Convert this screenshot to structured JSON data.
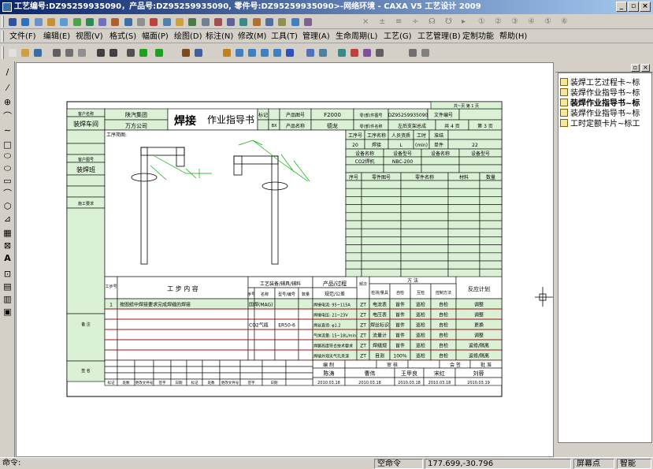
{
  "window": {
    "title": "工艺编号:DZ95259935090，产品号:DZ95259935090, 零件号:DZ95259935090>-网络环境 - CAXA V5 工艺设计 2009"
  },
  "menu": [
    "文件(F)",
    "编辑(E)",
    "视图(V)",
    "格式(S)",
    "幅面(P)",
    "绘图(D)",
    "标注(N)",
    "修改(M)",
    "工具(T)",
    "管理(A)",
    "生命周期(L)",
    "工艺(G)",
    "工艺管理(B)",
    "定制功能",
    "帮助(H)"
  ],
  "tb1_right": [
    "×",
    "±",
    "≡",
    "÷",
    "☊",
    "☋",
    "▸",
    "①",
    "②",
    "③",
    "④",
    "⑤",
    "⑥"
  ],
  "panel": {
    "files": [
      "装焊工艺过程卡~标",
      "装焊作业指导书~标",
      "装焊作业指导书~标",
      "装焊作业指导书~标",
      "工时定额卡片~标工"
    ]
  },
  "status": {
    "left": "命令:",
    "cmd": "空命令",
    "coords": "177.699,-30.796",
    "snap_label": "屏幕点",
    "mode": "智能"
  },
  "doc": {
    "top_tag": "共~页 第 1 页",
    "hdr_label1": "客户名称",
    "hdr_val1": "装焊车间",
    "cust_name": "陕汽集团",
    "cust_co": "万方公司",
    "title_big": "焊接",
    "title_rest": "作业指导书",
    "mark": "标记",
    "bi": "BX",
    "p_code_l": "产品图号",
    "p_code": "F2000",
    "p_name_l": "产品名称",
    "p_name": "德龙",
    "part_code_l": "零(部)件图号",
    "part_code": "DZ95259935090",
    "doc_no_l": "文件编号",
    "part_name_l": "零(部)件名称",
    "part_name": "左后支架总成",
    "pages": "共 4 页",
    "page": "第 3 页",
    "side_l1": "客户图号",
    "side_v1": "装焊班",
    "side_l2": "施工要求",
    "side_l3": "备 注",
    "side_l4": "签 名",
    "sketch_label": "工序简图:",
    "op_h": [
      "工序号",
      "工序名称",
      "人员资质",
      "工时",
      "准结"
    ],
    "op_v": [
      "20",
      "焊接",
      "L",
      "(min)",
      "单件",
      "22"
    ],
    "eq_h": [
      "设备名称",
      "设备型号",
      "设备名称",
      "设备型号"
    ],
    "eq_v": [
      "CO2焊机",
      "NBC-200"
    ],
    "part_h": [
      "序号",
      "零件图号",
      "零件名称",
      "材料",
      "数量"
    ],
    "steps_h1": "工步号",
    "steps_h2": "工 步 内 容",
    "steps_h3": "工艺装备/辅具/辅料",
    "steps_h4": "产品/过程",
    "steps_h5": "频次",
    "steps_h6": "方 法",
    "steps_h7": "反应计划",
    "sub_h": [
      "序号",
      "名称",
      "型号/编号",
      "数量",
      "规范/公差",
      "频次",
      "检测/量具",
      "自检",
      "互检",
      "控制方法"
    ],
    "steps": [
      {
        "no": "1",
        "txt": "按图纸中焊接要求完成焊缝的焊接",
        "eq": "国焊(MAG)",
        "model": "",
        "qty": "",
        "spec": "焊接电流: 95~115A",
        "f": "ZT",
        "m": "电流表",
        "c1": "首件",
        "c2": "巡检",
        "c3": "自检",
        "r": "调整"
      },
      {
        "no": "",
        "txt": "",
        "eq": "",
        "model": "",
        "qty": "",
        "spec": "焊接电压: 21~23V",
        "f": "ZT",
        "m": "电压表",
        "c1": "首件",
        "c2": "巡检",
        "c3": "自检",
        "r": "调整"
      },
      {
        "no": "",
        "txt": "",
        "eq": "CO2气瓶",
        "model": "ER50-6",
        "qty": "",
        "spec": "焊丝直径: φ1.2",
        "f": "ZT",
        "m": "焊丝标识",
        "c1": "首件",
        "c2": "巡检",
        "c3": "自检",
        "r": "更换"
      },
      {
        "no": "",
        "txt": "",
        "eq": "",
        "model": "",
        "qty": "",
        "spec": "气体流量: 15~18L/min",
        "f": "ZT",
        "m": "流量计",
        "c1": "首件",
        "c2": "巡检",
        "c3": "自检",
        "r": "调整"
      },
      {
        "no": "",
        "txt": "",
        "eq": "",
        "model": "",
        "qty": "",
        "spec": "焊脚高度符合技术要求",
        "f": "ZT",
        "m": "焊缝规",
        "c1": "首件",
        "c2": "巡检",
        "c3": "自检",
        "r": "返修/隔离"
      },
      {
        "no": "",
        "txt": "",
        "eq": "",
        "model": "",
        "qty": "",
        "spec": "焊缝外观无气孔夹渣",
        "f": "ZT",
        "m": "目测",
        "c1": "100%",
        "c2": "巡检",
        "c3": "自检",
        "r": "返修/隔离"
      }
    ],
    "sig_h": [
      "编 制",
      "审 核",
      "会 签",
      "批 准"
    ],
    "sig_n": [
      "陈涛",
      "曹伟",
      "王甲良",
      "宋红",
      "刘蓉"
    ],
    "sig_d": [
      "2010.03.18",
      "2010.03.18",
      "2010.03.18",
      "2010.03.18",
      "2010.03.19"
    ],
    "foot": [
      "标记",
      "处数",
      "更改文件号",
      "签字",
      "日期",
      "标记",
      "处数",
      "更改文件号",
      "签字",
      "日期"
    ]
  }
}
